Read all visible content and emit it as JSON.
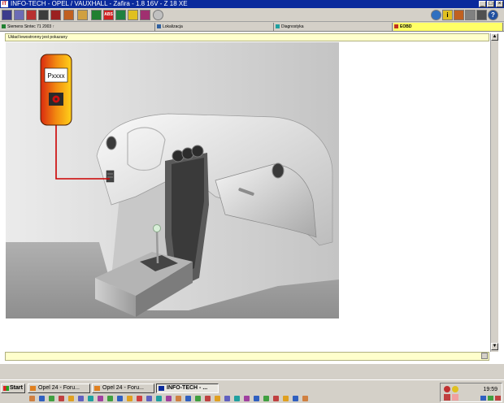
{
  "window": {
    "title": "INFO-TECH - OPEL / VAUXHALL - Zafira - 1.8 16V - Z 18 XE",
    "logo": "IT"
  },
  "window_controls": {
    "minimize": "_",
    "maximize": "□",
    "close": "×"
  },
  "toolbar": {
    "left_icons": [
      "car-icon",
      "search-icon",
      "document-icon",
      "gearbox-icon",
      "steering-icon",
      "wrench-icon",
      "battery-icon",
      "abs-icon",
      "ecu-icon",
      "wiring-icon",
      "sensor-icon",
      "light-icon",
      "settings-icon"
    ],
    "abs_label": "ABS",
    "right_icons": [
      "globe-icon",
      "info-icon",
      "notes-icon",
      "save-icon",
      "print-icon",
      "book-icon",
      "help-icon"
    ],
    "info_label": "i",
    "help_label": "?"
  },
  "tabs": [
    {
      "label": "Siemens Sintec 71 2003 ↑",
      "icon": "ecu-icon",
      "active": false
    },
    {
      "label": "Lokalizacja",
      "icon": "location-icon",
      "active": false
    },
    {
      "label": "Diagnostyka",
      "icon": "diagnostics-icon",
      "active": false
    },
    {
      "label": "EOBD",
      "icon": "eobd-icon",
      "active": true
    }
  ],
  "message": "Układ lewostronny jest pokazany",
  "diagram": {
    "connector_label": "Pxxxx"
  },
  "colors": {
    "title_bar": "#0a2a9c",
    "active_tab": "#ffff66",
    "message_bar": "#ffffcc",
    "connector_wire": "#cc0000"
  },
  "taskbar": {
    "start_label": "Start",
    "tasks": [
      {
        "label": "Opel 24 - Foru...",
        "active": false
      },
      {
        "label": "Opel 24 - Foru...",
        "active": false
      },
      {
        "label": "INFO-TECH - ...",
        "active": true
      }
    ],
    "clock": "19:59"
  }
}
